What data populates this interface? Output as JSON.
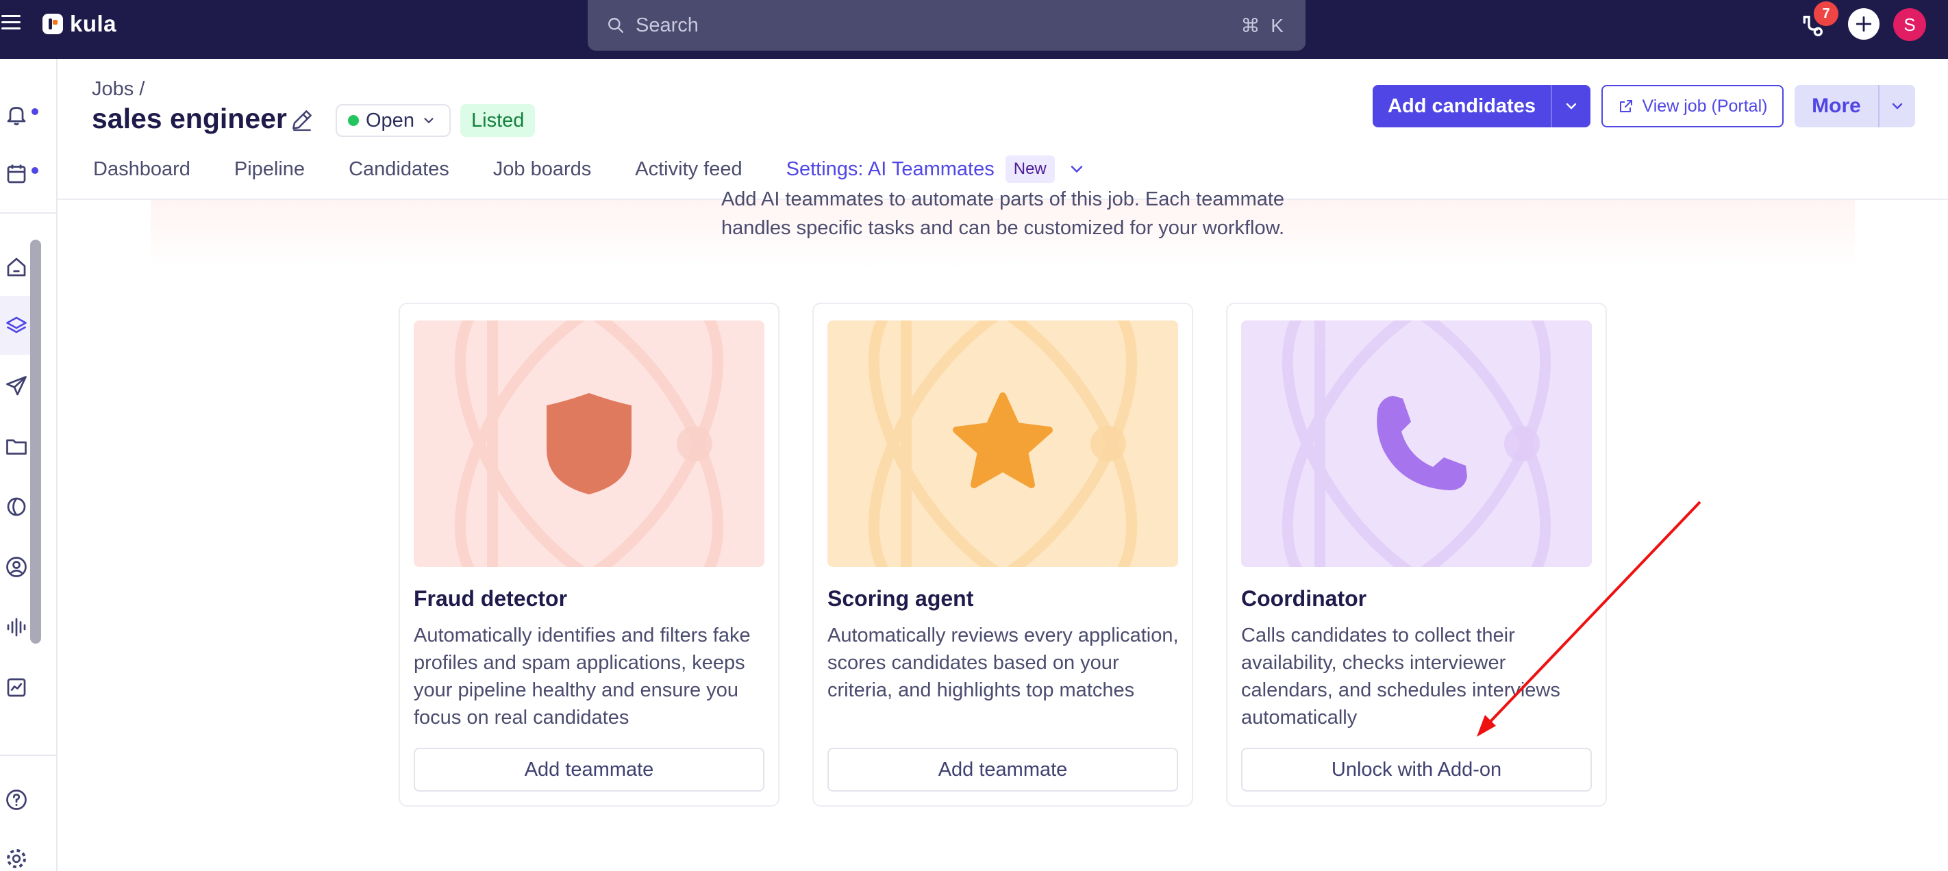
{
  "app": {
    "name": "kula"
  },
  "search": {
    "placeholder": "Search",
    "shortcut": "⌘ K"
  },
  "topbar": {
    "notification_count": "7",
    "avatar_initial": "S"
  },
  "header": {
    "breadcrumb": "Jobs /",
    "title": "sales engineer",
    "status": "Open",
    "listed_badge": "Listed",
    "add_candidates_label": "Add candidates",
    "view_job_label": "View job (Portal)",
    "more_label": "More"
  },
  "tabs": [
    {
      "label": "Dashboard"
    },
    {
      "label": "Pipeline"
    },
    {
      "label": "Candidates"
    },
    {
      "label": "Job boards"
    },
    {
      "label": "Activity feed"
    },
    {
      "label": "Settings: AI Teammates",
      "badge": "New",
      "active": true
    }
  ],
  "intro": {
    "line1": "Add AI teammates to automate parts of this job. Each teammate",
    "line2": "handles specific tasks and can be customized for your workflow."
  },
  "cards": [
    {
      "title": "Fraud detector",
      "description": "Automatically identifies and filters fake profiles and spam applications, keeps your pipeline healthy and ensure you focus on real candidates",
      "button": "Add teammate",
      "icon": "shield-icon",
      "bg": "#fde4e0",
      "icon_color": "#e07a5f"
    },
    {
      "title": "Scoring agent",
      "description": "Automatically reviews every application, scores candidates based on your criteria, and highlights top matches",
      "button": "Add teammate",
      "icon": "star-icon",
      "bg": "#fde7c4",
      "icon_color": "#f4a236"
    },
    {
      "title": "Coordinator",
      "description": "Calls candidates to collect their availability, checks interviewer calendars, and schedules interviews automatically",
      "button": "Unlock with Add-on",
      "icon": "phone-icon",
      "bg": "#ede1fb",
      "icon_color": "#a674ec"
    }
  ],
  "colors": {
    "accent": "#4f46e5",
    "topbar": "#1e1b4b",
    "annotation_arrow": "#ee1111"
  }
}
